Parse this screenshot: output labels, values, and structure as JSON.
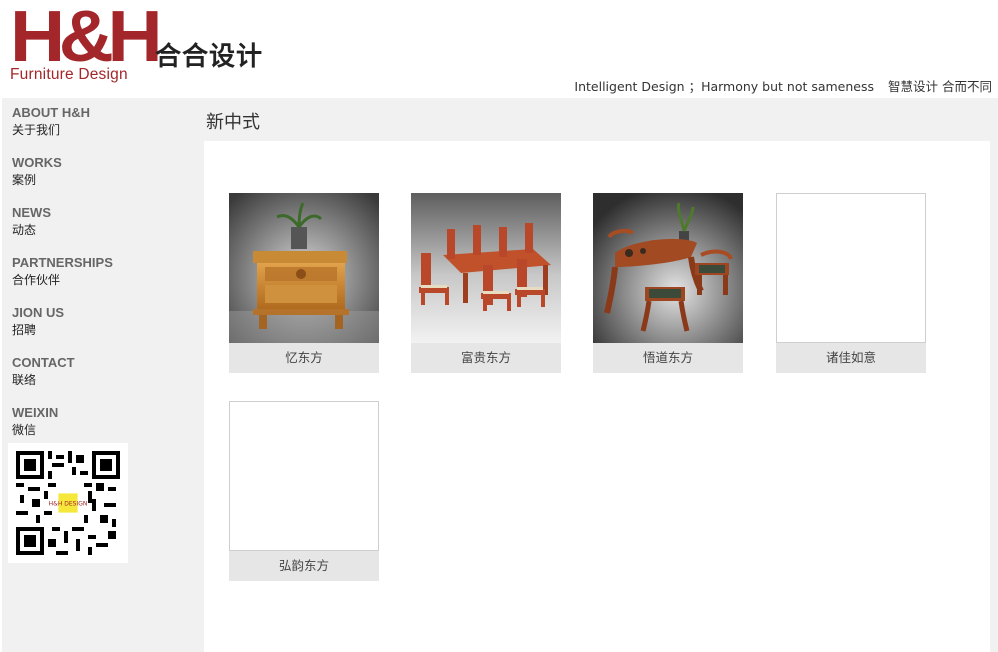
{
  "header": {
    "logo_mark": "H&H",
    "logo_sub": "Furniture Design",
    "brand_cn": "合合设计",
    "slogan_en": "Intelligent Design ；Harmony but not sameness",
    "slogan_cn": "智慧设计 合而不同"
  },
  "sidebar": {
    "items": [
      {
        "en": "ABOUT H&H",
        "cn": "关于我们"
      },
      {
        "en": "WORKS",
        "cn": "案例"
      },
      {
        "en": "NEWS",
        "cn": "动态"
      },
      {
        "en": "PARTNERSHIPS",
        "cn": "合作伙伴"
      },
      {
        "en": "JION US",
        "cn": "招聘"
      },
      {
        "en": "CONTACT",
        "cn": "联络"
      },
      {
        "en": "WEIXIN",
        "cn": "微信"
      }
    ],
    "qr_badge": "H&H DESIGN"
  },
  "main": {
    "section_title": "新中式",
    "products": [
      {
        "caption": "忆东方",
        "image": "cabinet"
      },
      {
        "caption": "富贵东方",
        "image": "dining-set"
      },
      {
        "caption": "悟道东方",
        "image": "tea-set"
      },
      {
        "caption": "诸佳如意",
        "image": "blank"
      },
      {
        "caption": "弘韵东方",
        "image": "blank"
      }
    ]
  },
  "colors": {
    "brand_red": "#a3262a",
    "sidebar_bg": "#f1f1f1",
    "caption_bg": "#e6e6e6"
  }
}
